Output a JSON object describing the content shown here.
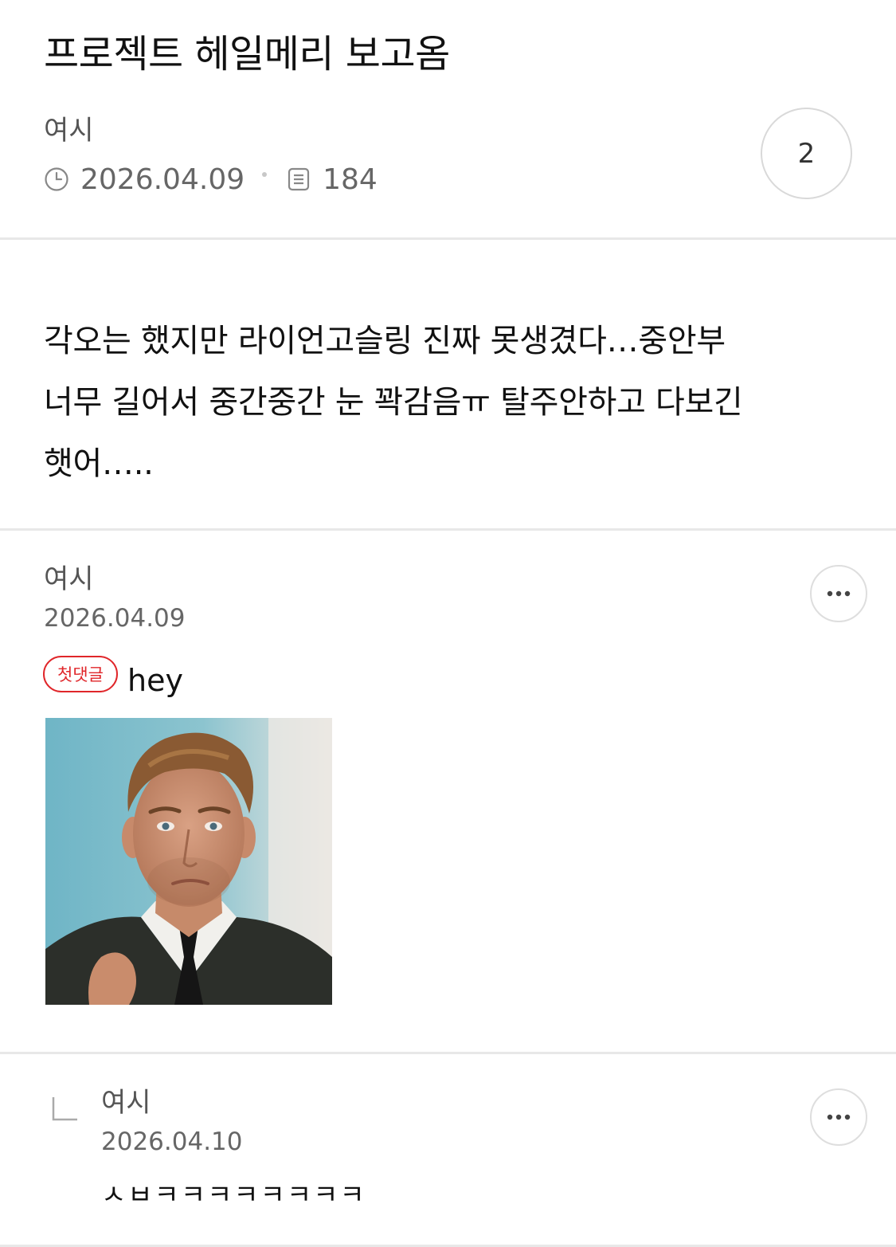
{
  "post": {
    "title": "프로젝트 헤일메리 보고옴",
    "author": "여시",
    "date": "2026.04.09",
    "views": "184",
    "comment_count": "2",
    "body": "각오는 했지만 라이언고슬링 진짜 못생겼다…중안부 너무 길어서 중간중간 눈 꽉감음ㅠ 탈주안하고 다보긴 햇어…..",
    "body_lines": [
      "각오는 했지만 라이언고슬링 진짜 못생겼다…중안부",
      "너무 길어서 중간중간 눈 꽉감음ㅠ 탈주안하고 다보긴",
      "햇어….."
    ]
  },
  "comments": [
    {
      "author": "여시",
      "date": "2026.04.09",
      "badge": "첫댓글",
      "text": "hey",
      "has_image": true,
      "more_icon": "more-dots-icon"
    },
    {
      "author": "여시",
      "date": "2026.04.10",
      "text": "ㅅㅂㅋㅋㅋㅋㅋㅋㅋㅋ",
      "is_reply": true,
      "reply_icon": "reply-arrow-icon",
      "more_icon": "more-dots-icon"
    }
  ],
  "icons": {
    "date": "clock-icon",
    "views": "document-icon"
  },
  "colors": {
    "badge_red": "#e0262a",
    "divider": "#e8e8e8",
    "meta_text": "#666666"
  }
}
